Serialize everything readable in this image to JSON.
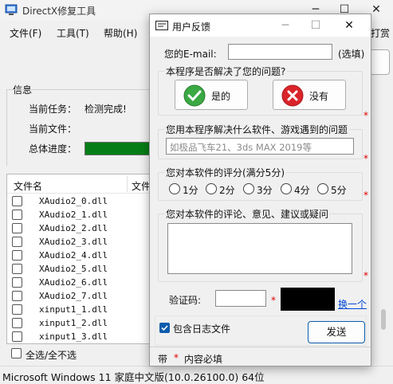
{
  "main_window": {
    "title": "DirectX修复工具",
    "menu": [
      "文件(F)",
      "工具(T)",
      "帮助(H)"
    ],
    "menu_right": "打赏",
    "info_label": "信息",
    "info_rows": [
      {
        "label": "当前任务：",
        "value": "检测完成!"
      },
      {
        "label": "当前文件：",
        "value": ""
      },
      {
        "label": "总体进度：",
        "value": ""
      }
    ],
    "progress_fraction": 1.0,
    "file_list": {
      "columns": [
        "文件名",
        "文件"
      ],
      "rows": [
        "XAudio2_0.dll",
        "XAudio2_1.dll",
        "XAudio2_2.dll",
        "XAudio2_3.dll",
        "XAudio2_4.dll",
        "XAudio2_5.dll",
        "XAudio2_6.dll",
        "XAudio2_7.dll",
        "xinput1_1.dll",
        "xinput1_2.dll",
        "xinput1_3.dll"
      ]
    },
    "select_all": "全选/全不选",
    "status": "Microsoft Windows 11 家庭中文版(10.0.26100.0) 64位"
  },
  "dialog": {
    "title": "用户反馈",
    "email_label": "您的E-mail:",
    "email_value": "",
    "email_optional": "(选填)",
    "q1_label": "本程序是否解决了您的问题?",
    "yes_label": "是的",
    "no_label": "没有",
    "q2_label": "您用本程序解决什么软件、游戏遇到的问题",
    "q2_placeholder": "如极品飞车21、3ds MAX 2019等",
    "q3_label": "您对本软件的评分(满分5分)",
    "ratings": [
      "1分",
      "2分",
      "3分",
      "4分",
      "5分"
    ],
    "q4_label": "您对本软件的评论、意见、建议或疑问",
    "captcha_label": "验证码:",
    "captcha_link": "换一个",
    "include_log": "包含日志文件",
    "send_label": "发送",
    "footer_prefix": "带",
    "footer_star": "*",
    "footer_text": "内容必填",
    "required_mark": "*"
  },
  "colors": {
    "accent": "#0b5cad",
    "progress": "#067d17",
    "required": "#e00000",
    "link": "#0046d5"
  }
}
